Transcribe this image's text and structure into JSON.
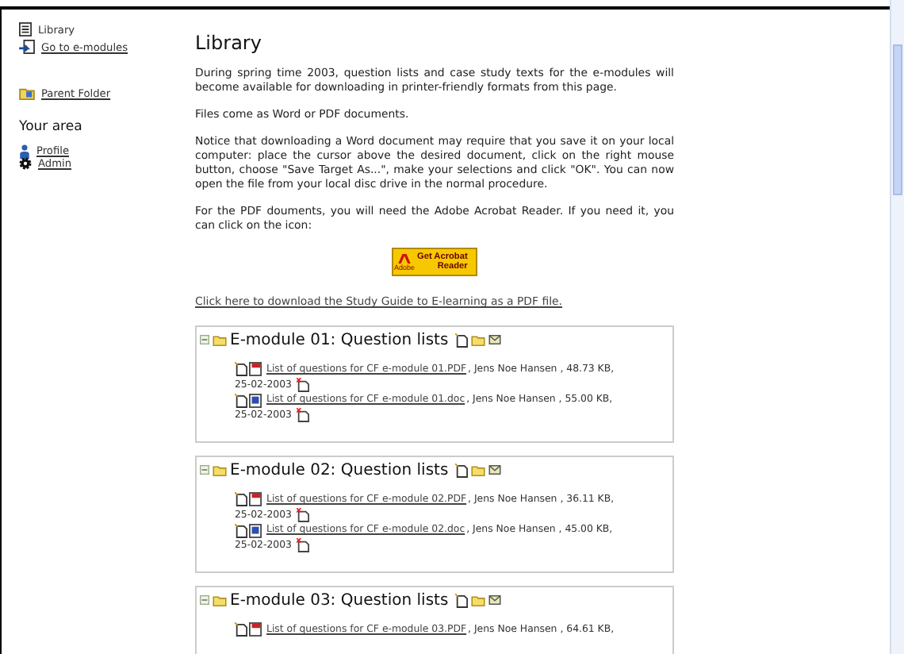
{
  "sidebar": {
    "items": [
      {
        "label": "Library",
        "kind": "page",
        "link": false
      },
      {
        "label": "Go to e-modules",
        "kind": "goto",
        "link": true
      }
    ],
    "parent_folder": "Parent Folder",
    "area_title": "Your area",
    "area_items": [
      {
        "label": "Profile",
        "kind": "person"
      },
      {
        "label": "Admin",
        "kind": "gear"
      }
    ]
  },
  "main": {
    "title": "Library",
    "paragraphs": [
      "During spring time 2003, question lists and case study texts for the e-modules will become available for downloading in printer-friendly formats from this page.",
      "Files come as Word or PDF documents.",
      "Notice that downloading a Word document may require that you save it on your local computer: place the cursor above the desired document, click on the right mouse button, choose \"Save Target As...\", make your selections and click \"OK\". You can now open the file from your local disc drive in the normal procedure.",
      "For the PDF douments, you will need the Adobe Acrobat Reader. If you need it, you can click on the icon:"
    ],
    "acrobat_badge": {
      "line_1": "Get Acrobat",
      "line_2": "Reader",
      "brand": "Adobe"
    },
    "study_guide_link": "Click here to download the Study Guide to E-learning as a PDF file.",
    "modules": [
      {
        "title": "E-module 01: Question lists",
        "files": [
          {
            "kind": "pdf",
            "name": "List of questions for CF e-module 01.PDF",
            "details": ", Jens Noe Hansen , 48.73 KB,",
            "date": "25-02-2003"
          },
          {
            "kind": "doc",
            "name": "List of questions for CF e-module 01.doc",
            "details": ", Jens Noe Hansen , 55.00 KB,",
            "date": "25-02-2003"
          }
        ]
      },
      {
        "title": "E-module 02: Question lists",
        "files": [
          {
            "kind": "pdf",
            "name": "List of questions for CF e-module 02.PDF",
            "details": ", Jens Noe Hansen , 36.11 KB,",
            "date": "25-02-2003"
          },
          {
            "kind": "doc",
            "name": "List of questions for CF e-module 02.doc",
            "details": ", Jens Noe Hansen , 45.00 KB,",
            "date": "25-02-2003"
          }
        ]
      },
      {
        "title": "E-module 03: Question lists",
        "files": [
          {
            "kind": "pdf",
            "name": "List of questions for CF e-module 03.PDF",
            "details": ", Jens Noe Hansen , 64.61 KB,"
          }
        ]
      }
    ]
  }
}
